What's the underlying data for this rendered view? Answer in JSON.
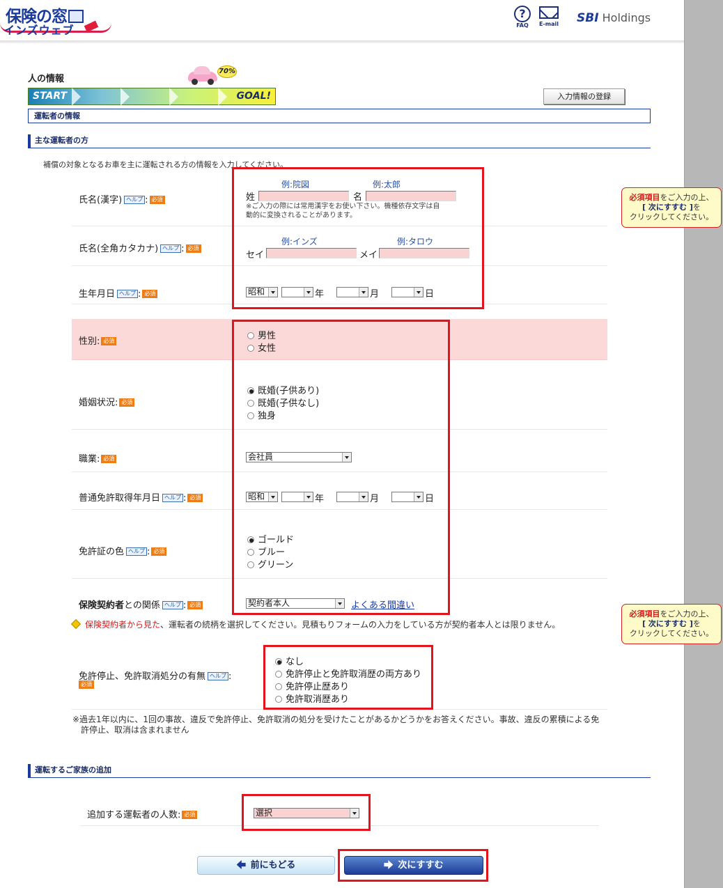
{
  "header": {
    "logo_main": "保険の窓",
    "logo_sub": "インズウェブ",
    "faq_label": "FAQ",
    "email_label": "E-mail",
    "sbi_brand": "SBI",
    "sbi_suffix": "Holdings"
  },
  "page": {
    "title": "人の情報",
    "progress_start": "START",
    "progress_goal": "GOAL!",
    "progress_percent": "70%",
    "register_button": "入力情報の登録",
    "section_bar": "運転者の情報"
  },
  "main_driver": {
    "heading": "主な運転者の方",
    "intro": "補償の対象となるお車を主に運転される方の情報を入力してください。",
    "name_kanji": {
      "label": "氏名(漢字)",
      "help": "ヘルプ",
      "colon": ":",
      "req": "必須",
      "last_prefix": "姓",
      "first_prefix": "名",
      "last_example": "例:院図",
      "first_example": "例:太郎",
      "note_line1": "※ご入力の際には常用漢字をお使い下さい。機種依存文字は自",
      "note_line2": "動的に変換されることがあります。"
    },
    "name_kana": {
      "label": "氏名(全角カタカナ)",
      "last_prefix": "セイ",
      "first_prefix": "メイ",
      "last_example": "例:インズ",
      "first_example": "例:タロウ"
    },
    "birthdate": {
      "label": "生年月日",
      "era": "昭和",
      "year_suffix": "年",
      "month_suffix": "月",
      "day_suffix": "日"
    },
    "gender": {
      "label": "性別:",
      "options": [
        "男性",
        "女性"
      ]
    },
    "marital": {
      "label": "婚姻状況:",
      "options": [
        "既婚(子供あり)",
        "既婚(子供なし)",
        "独身"
      ]
    },
    "occupation": {
      "label": "職業:",
      "value": "会社員"
    },
    "license_date": {
      "label": "普通免許取得年月日",
      "era": "昭和"
    },
    "license_color": {
      "label": "免許証の色",
      "options": [
        "ゴールド",
        "ブルー",
        "グリーン"
      ]
    },
    "relation": {
      "label_bold": "保険契約者",
      "label_rest": "との関係",
      "value": "契約者本人",
      "faq_link": "よくある間違い",
      "warn_red": "保険契約者から見た",
      "warn_text": "、運転者の続柄を選択してください。見積もりフォームの入力をしている方が契約者本人とは限りません。"
    },
    "suspension": {
      "label": "免許停止、免許取消処分の有無",
      "options": [
        "なし",
        "免許停止と免許取消歴の両方あり",
        "免許停止歴あり",
        "免許取消歴あり"
      ],
      "note_line1": "※過去1年以内に、1回の事故、違反で免許停止、免許取消の処分を受けたことがあるかどうかをお答えください。事故、違反の累積による免",
      "note_line2": "許停止、取消は含まれません"
    }
  },
  "family": {
    "heading": "運転するご家族の追加",
    "label": "追加する運転者の人数:",
    "value": "選択"
  },
  "tooltip": {
    "red": "必須項目",
    "line1_rest": "をご入力の上、",
    "line2": "[ 次にすすむ ]",
    "line2_suffix": "を",
    "line3": "クリックしてください。"
  },
  "nav": {
    "back": "前にもどる",
    "next": "次にすすむ"
  },
  "colors": {
    "accent_red": "#e3141d",
    "brand_blue": "#1b3b9c",
    "required_orange": "#f07c14",
    "input_pink": "#fbd2d2"
  }
}
